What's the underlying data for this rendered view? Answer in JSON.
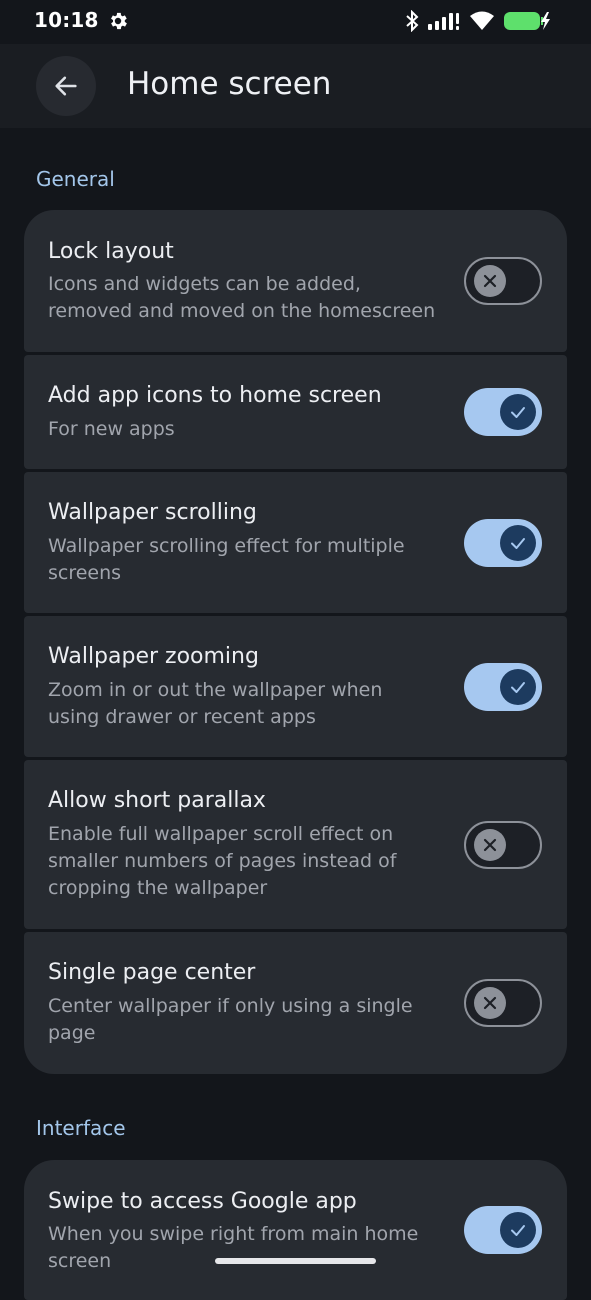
{
  "status_bar": {
    "time": "10:18",
    "icons": [
      "gear-icon",
      "bluetooth-icon",
      "signal-icon",
      "wifi-icon",
      "battery-charging-icon"
    ],
    "battery_color": "#5ee06c"
  },
  "app_bar": {
    "title": "Home screen",
    "back_icon": "arrow-left-icon"
  },
  "sections": {
    "general": {
      "title": "General",
      "items": [
        {
          "label": "Lock layout",
          "desc": "Icons and widgets can be added, removed and moved on the homescreen",
          "enabled": false
        },
        {
          "label": "Add app icons to home screen",
          "desc": "For new apps",
          "enabled": true
        },
        {
          "label": "Wallpaper scrolling",
          "desc": "Wallpaper scrolling effect for multiple screens",
          "enabled": true
        },
        {
          "label": "Wallpaper zooming",
          "desc": "Zoom in or out the wallpaper when using drawer or recent apps",
          "enabled": true
        },
        {
          "label": "Allow short parallax",
          "desc": "Enable full wallpaper scroll effect on smaller numbers of pages instead of cropping the wallpaper",
          "enabled": false
        },
        {
          "label": "Single page center",
          "desc": "Center wallpaper if only using a single page",
          "enabled": false
        }
      ]
    },
    "interface": {
      "title": "Interface",
      "items": [
        {
          "label": "Swipe to access Google app",
          "desc": "When you swipe right from main home screen",
          "enabled": true
        }
      ]
    }
  },
  "colors": {
    "accent": "#a6c8f0",
    "toggle_knob_on": "#1d3b5f",
    "toggle_off": "#8d9199",
    "card_bg": "#272b31",
    "page_bg": "#13161b"
  }
}
